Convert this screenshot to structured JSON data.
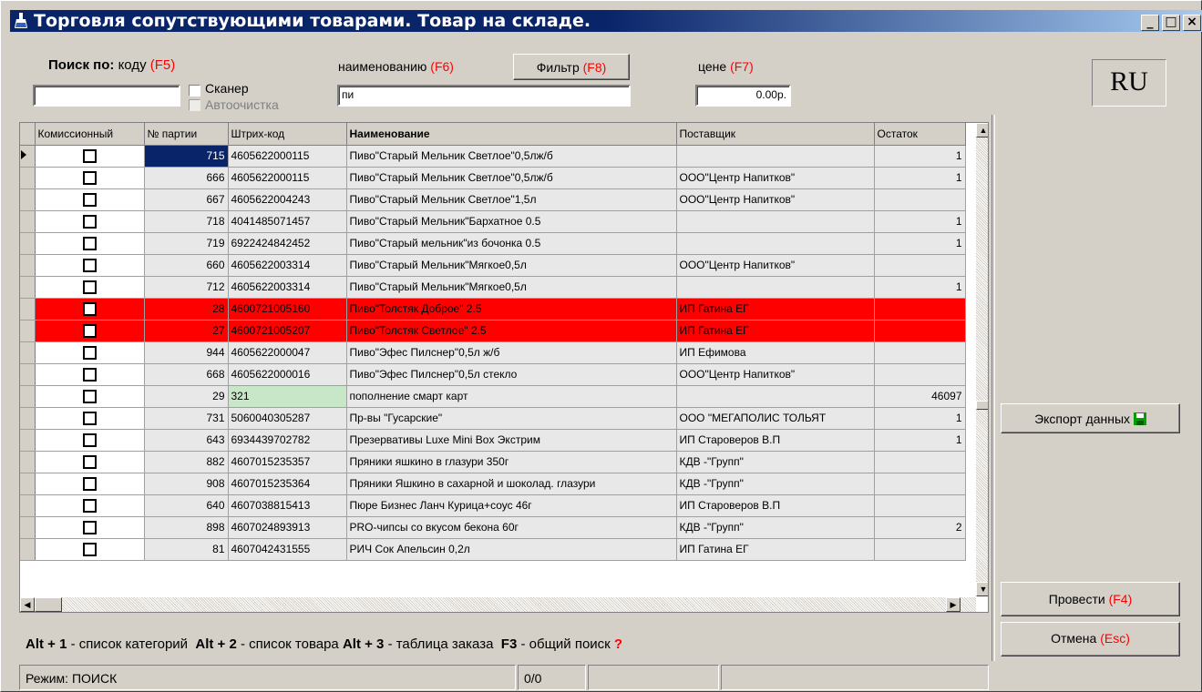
{
  "window": {
    "title": "Торговля сопутствующими товарами. Товар на складе.",
    "controls": {
      "minimize": "_",
      "maximize": "□",
      "close": "×"
    }
  },
  "search": {
    "label_bold": "Поиск по:",
    "by_code": "коду",
    "by_code_key": "(F5)",
    "code_value": "",
    "scanner_label": "Сканер",
    "autoclean_label": "Автоочистка",
    "by_name": "наименованию",
    "by_name_key": "(F6)",
    "name_value": "пи",
    "filter_button": "Фильтр",
    "filter_key": "(F8)",
    "by_price": "цене",
    "by_price_key": "(F7)",
    "price_value": "0.00р.",
    "lang": "RU"
  },
  "grid": {
    "columns": [
      "Комиссионный",
      "№ партии",
      "Штрих-код",
      "Наименование",
      "Поставщик",
      "Остаток"
    ],
    "rows": [
      {
        "party": "715",
        "barcode": "4605622000115",
        "name": "Пиво\"Старый Мельник Светлое\"0,5лж/б",
        "supplier": "",
        "rest": "1",
        "style": "current"
      },
      {
        "party": "666",
        "barcode": "4605622000115",
        "name": "Пиво\"Старый Мельник Светлое\"0,5лж/б",
        "supplier": "ООО\"Центр Напитков\"",
        "rest": "1",
        "style": "gray"
      },
      {
        "party": "667",
        "barcode": "4605622004243",
        "name": "Пиво\"Старый Мельник Светлое\"1,5л",
        "supplier": "ООО\"Центр Напитков\"",
        "rest": "",
        "style": "gray"
      },
      {
        "party": "718",
        "barcode": "4041485071457",
        "name": "Пиво\"Старый Мельник\"Бархатное 0.5",
        "supplier": "",
        "rest": "1",
        "style": "gray"
      },
      {
        "party": "719",
        "barcode": "6922424842452",
        "name": "Пиво\"Старый мельник\"из бочонка 0.5",
        "supplier": "",
        "rest": "1",
        "style": "gray"
      },
      {
        "party": "660",
        "barcode": "4605622003314",
        "name": "Пиво\"Старый Мельник\"Мягкое0,5л",
        "supplier": "ООО\"Центр Напитков\"",
        "rest": "",
        "style": "gray"
      },
      {
        "party": "712",
        "barcode": "4605622003314",
        "name": "Пиво\"Старый Мельник\"Мягкое0,5л",
        "supplier": "",
        "rest": "1",
        "style": "gray"
      },
      {
        "party": "28",
        "barcode": "4600721005160",
        "name": "Пиво\"Толстяк Доброе\" 2.5",
        "supplier": "ИП Гатина ЕГ",
        "rest": "",
        "style": "red"
      },
      {
        "party": "27",
        "barcode": "4600721005207",
        "name": "Пиво\"Толстяк Светлое\" 2.5",
        "supplier": "ИП Гатина ЕГ",
        "rest": "",
        "style": "red"
      },
      {
        "party": "944",
        "barcode": "4605622000047",
        "name": "Пиво\"Эфес Пилснер\"0,5л ж/б",
        "supplier": "ИП Ефимова",
        "rest": "",
        "style": "gray"
      },
      {
        "party": "668",
        "barcode": "4605622000016",
        "name": "Пиво\"Эфес Пилснер\"0,5л стекло",
        "supplier": "ООО\"Центр Напитков\"",
        "rest": "",
        "style": "gray"
      },
      {
        "party": "29",
        "barcode": "321",
        "name": "пополнение смарт карт",
        "supplier": "",
        "rest": "46097",
        "style": "green"
      },
      {
        "party": "731",
        "barcode": "5060040305287",
        "name": "Пр-вы \"Гусарские\"",
        "supplier": "ООО \"МЕГАПОЛИС ТОЛЬЯТ",
        "rest": "1",
        "style": "gray"
      },
      {
        "party": "643",
        "barcode": "6934439702782",
        "name": "Презервативы Luxe Mini Box Экстрим",
        "supplier": "ИП Староверов В.П",
        "rest": "1",
        "style": "gray"
      },
      {
        "party": "882",
        "barcode": "4607015235357",
        "name": "Пряники яшкино в глазури 350г",
        "supplier": "КДВ -\"Групп\"",
        "rest": "",
        "style": "gray"
      },
      {
        "party": "908",
        "barcode": "4607015235364",
        "name": "Пряники Яшкино в сахарной и шоколад. глазури",
        "supplier": "КДВ -\"Групп\"",
        "rest": "",
        "style": "gray"
      },
      {
        "party": "640",
        "barcode": "4607038815413",
        "name": "Пюре Бизнес Ланч Курица+соус 46г",
        "supplier": "ИП Староверов В.П",
        "rest": "",
        "style": "gray"
      },
      {
        "party": "898",
        "barcode": "4607024893913",
        "name": "PRO-чипсы со вкусом бекона 60г",
        "supplier": "КДВ -\"Групп\"",
        "rest": "2",
        "style": "gray"
      },
      {
        "party": "81",
        "barcode": "4607042431555",
        "name": "РИЧ Сок Апельсин 0,2л",
        "supplier": "ИП Гатина ЕГ",
        "rest": "",
        "style": "gray"
      }
    ]
  },
  "actions": {
    "export": "Экспорт данных",
    "post": "Провести",
    "post_key": "(F4)",
    "cancel": "Отмена",
    "cancel_key": "(Esc)"
  },
  "hints": {
    "k1": "Alt + 1",
    "t1": "- список категорий",
    "k2": "Alt + 2",
    "t2": "- список товара",
    "k3": "Alt + 3",
    "t3": "- таблица заказа",
    "k4": "F3",
    "t4": "- общий поиск",
    "q": "?"
  },
  "status": {
    "mode": "Режим: ПОИСК",
    "count": "0/0"
  }
}
